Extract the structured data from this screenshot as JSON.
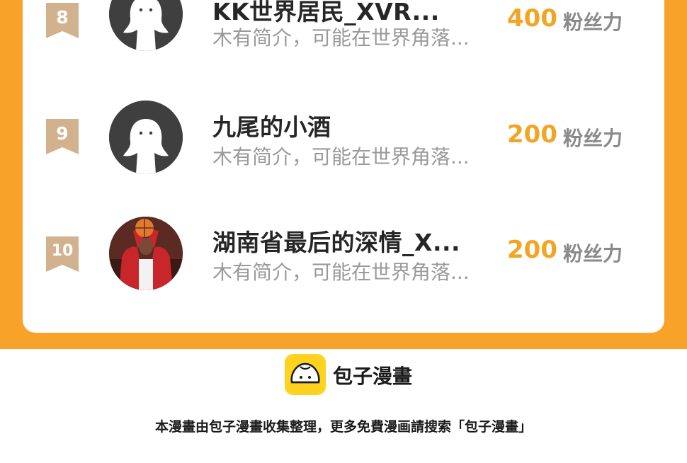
{
  "leaderboard": {
    "rows": [
      {
        "rank": "8",
        "name": "KK世界居民_XVR...",
        "bio": "木有简介，可能在世界角落...",
        "score": "400",
        "score_unit": "粉丝力",
        "avatar": "default-ghost-avatar"
      },
      {
        "rank": "9",
        "name": "九尾的小酒",
        "bio": "木有简介，可能在世界角落...",
        "score": "200",
        "score_unit": "粉丝力",
        "avatar": "default-ghost-avatar"
      },
      {
        "rank": "10",
        "name": "湖南省最后的深情_X...",
        "bio": "木有简介，可能在世界角落...",
        "score": "200",
        "score_unit": "粉丝力",
        "avatar": "basketball-player-photo"
      }
    ]
  },
  "footer": {
    "logo_icon": "bun-logo-icon",
    "brand": "包子漫畫",
    "note": "本漫畫由包子漫畫收集整理，更多免費漫画請搜索「包子漫畫」"
  },
  "colors": {
    "accent_orange": "#f8a22a",
    "score_gold": "#f2a524",
    "badge_tan": "#d2b28e",
    "logo_yellow": "#ffd21f"
  }
}
